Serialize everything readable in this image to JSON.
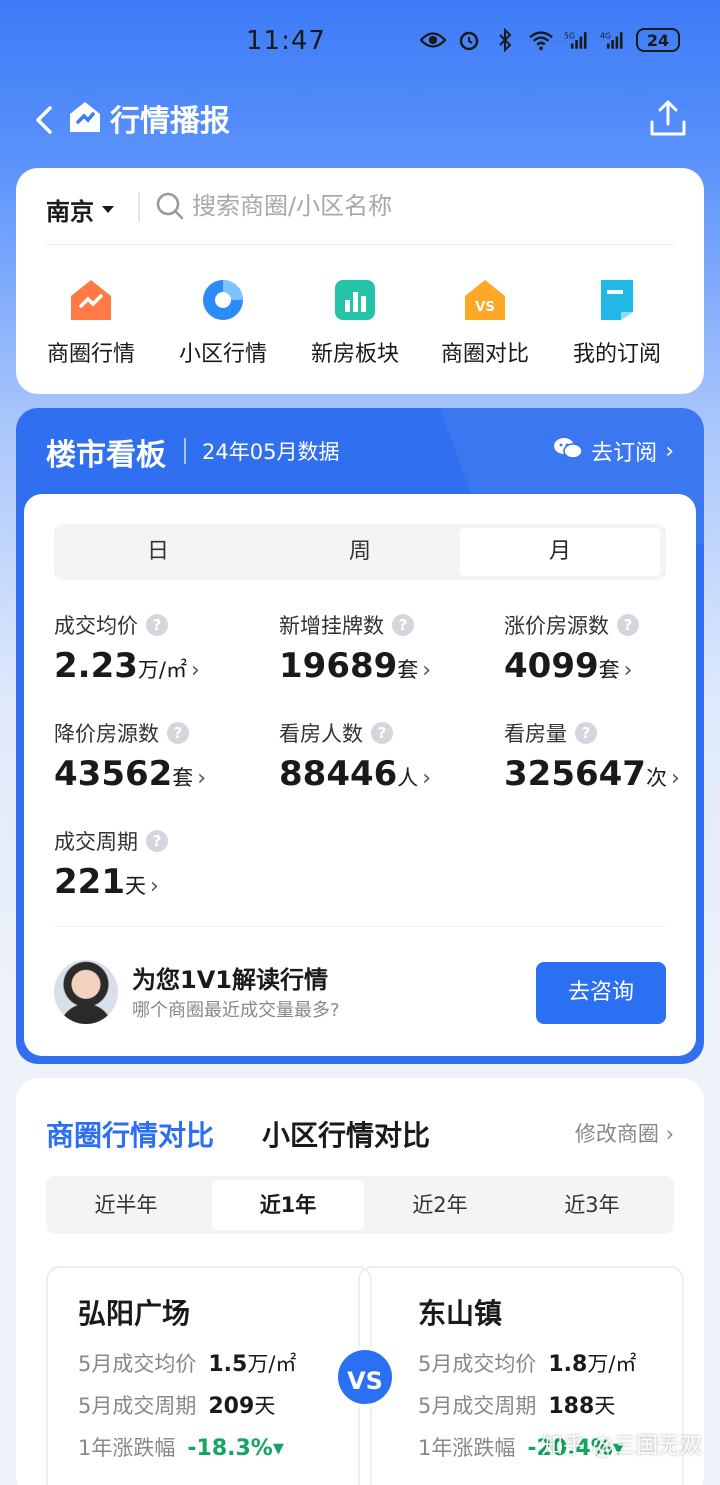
{
  "status": {
    "time": "11:47",
    "battery": "24"
  },
  "nav": {
    "title": "行情播报"
  },
  "search": {
    "city": "南京",
    "placeholder": "搜索商圈/小区名称"
  },
  "quick_actions": [
    {
      "label": "商圈行情",
      "icon": "area-trend-icon"
    },
    {
      "label": "小区行情",
      "icon": "community-pie-icon"
    },
    {
      "label": "新房板块",
      "icon": "new-house-chart-icon"
    },
    {
      "label": "商圈对比",
      "icon": "vs-compare-icon"
    },
    {
      "label": "我的订阅",
      "icon": "subscription-icon"
    }
  ],
  "board": {
    "title": "楼市看板",
    "subtitle": "24年05月数据",
    "subscribe": "去订阅",
    "periods": [
      "日",
      "周",
      "月"
    ],
    "active_period": "月",
    "metrics": [
      {
        "label": "成交均价",
        "value": "2.23",
        "unit": "万/㎡"
      },
      {
        "label": "新增挂牌数",
        "value": "19689",
        "unit": "套"
      },
      {
        "label": "涨价房源数",
        "value": "4099",
        "unit": "套"
      },
      {
        "label": "降价房源数",
        "value": "43562",
        "unit": "套"
      },
      {
        "label": "看房人数",
        "value": "88446",
        "unit": "人"
      },
      {
        "label": "看房量",
        "value": "325647",
        "unit": "次"
      },
      {
        "label": "成交周期",
        "value": "221",
        "unit": "天"
      }
    ],
    "consult": {
      "title": "为您1V1解读行情",
      "subtitle": "哪个商圈最近成交量最多?",
      "button": "去咨询"
    }
  },
  "compare": {
    "tab_active": "商圈行情对比",
    "tab_other": "小区行情对比",
    "edit": "修改商圈",
    "ranges": [
      "近半年",
      "近1年",
      "近2年",
      "近3年"
    ],
    "active_range": "近1年",
    "vs": "VS",
    "left": {
      "name": "弘阳广场",
      "price_label": "5月成交均价",
      "price": "1.5",
      "price_unit": "万/㎡",
      "cycle_label": "5月成交周期",
      "cycle": "209",
      "cycle_unit": "天",
      "change_label": "1年涨跌幅",
      "change": "-18.3%▾"
    },
    "right": {
      "name": "东山镇",
      "price_label": "5月成交均价",
      "price": "1.8",
      "price_unit": "万/㎡",
      "cycle_label": "5月成交周期",
      "cycle": "188",
      "cycle_unit": "天",
      "change_label": "1年涨跌幅",
      "change": "-20.4%▾"
    }
  },
  "watermark": "知乎 @三国无双",
  "colors": {
    "primary": "#2b6ff2",
    "down": "#11a661",
    "text": "#1a1a1a"
  }
}
